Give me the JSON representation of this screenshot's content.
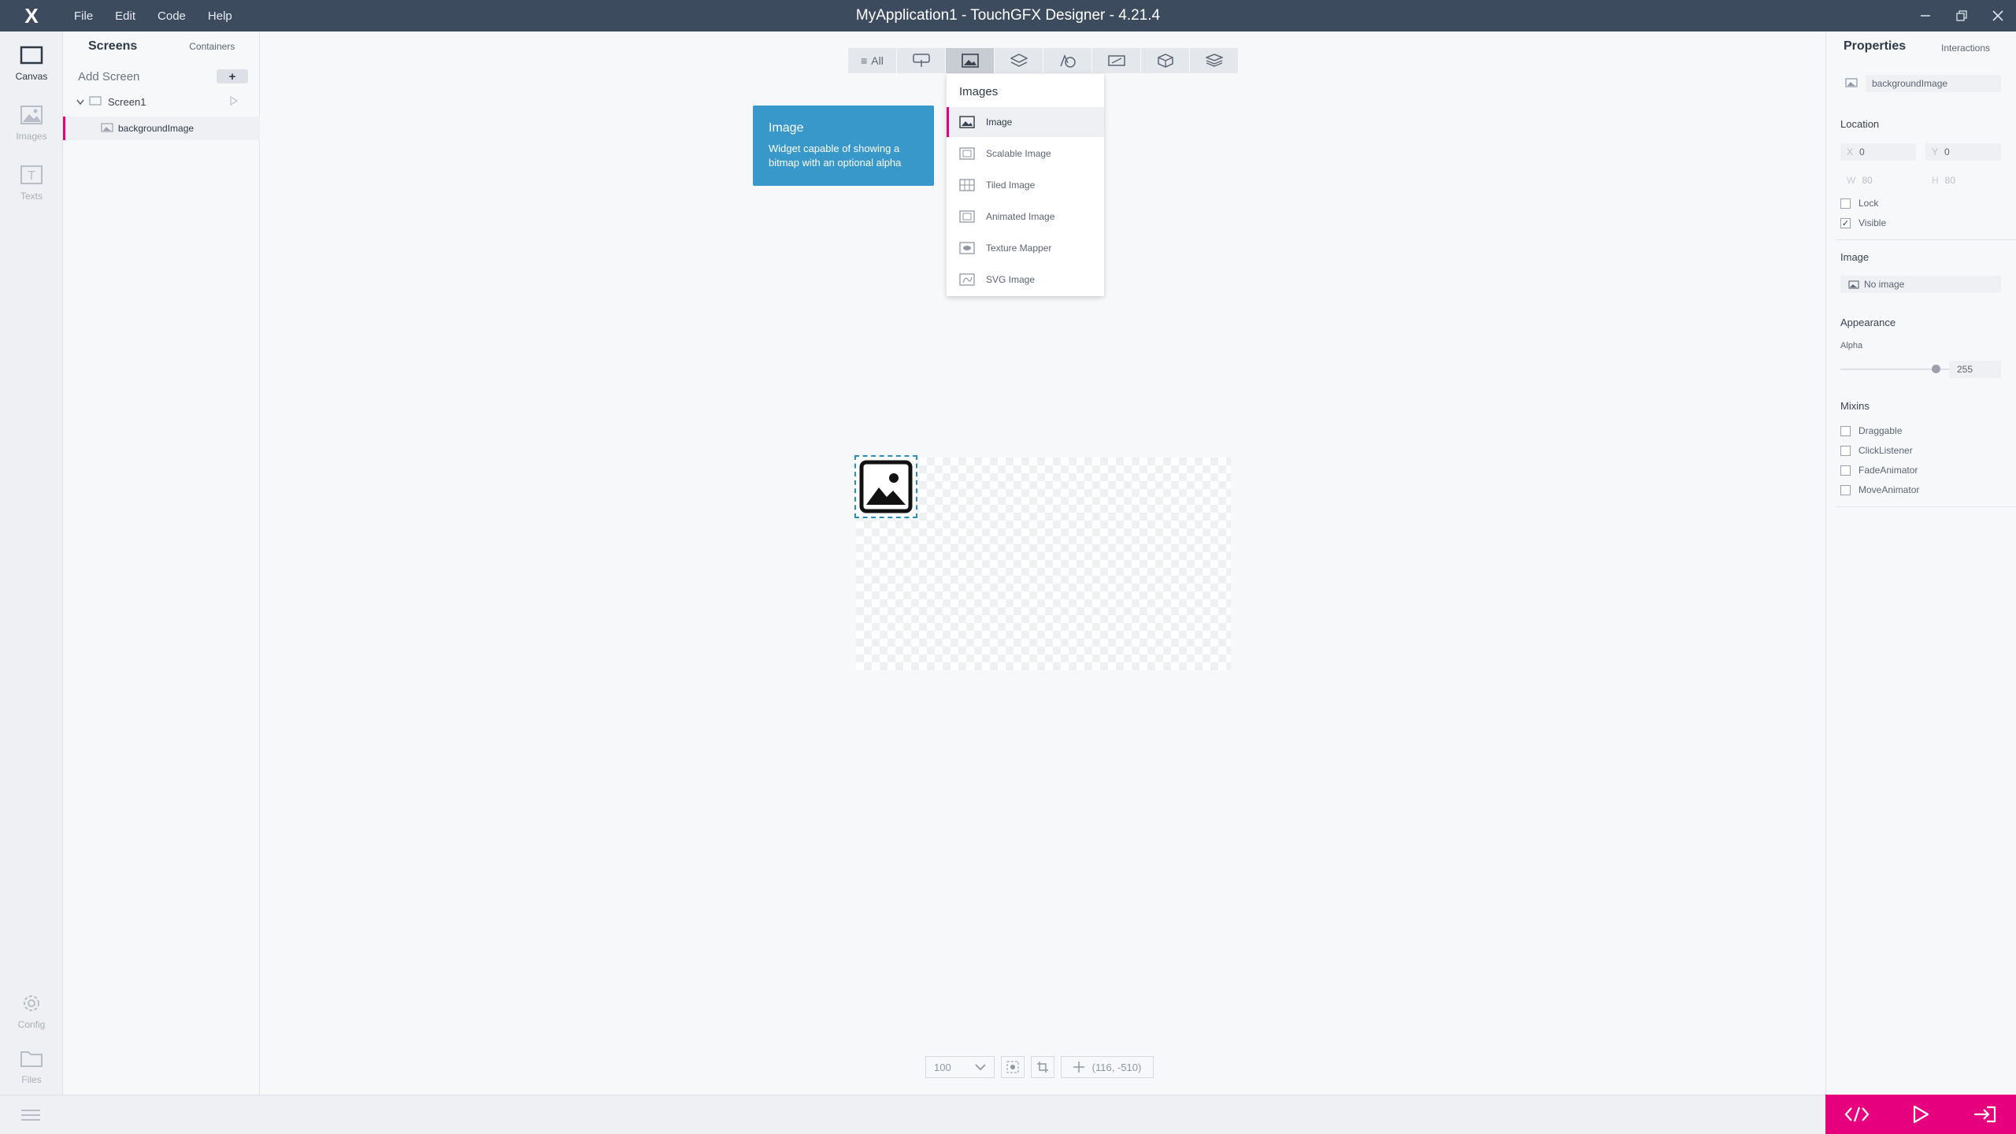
{
  "window": {
    "title": "MyApplication1 - TouchGFX Designer - 4.21.4",
    "logo": "X",
    "menu": [
      "File",
      "Edit",
      "Code",
      "Help"
    ],
    "controls": [
      "minimize-icon",
      "restore-icon",
      "close-icon"
    ]
  },
  "rail": {
    "items": [
      {
        "label": "Canvas",
        "icon": "canvas-icon",
        "active": true
      },
      {
        "label": "Images",
        "icon": "images-icon",
        "active": false
      },
      {
        "label": "Texts",
        "icon": "texts-icon",
        "active": false
      },
      {
        "label": "Config",
        "icon": "gear-icon",
        "active": false
      },
      {
        "label": "Files",
        "icon": "folder-icon",
        "active": false
      }
    ]
  },
  "screens_panel": {
    "tab_screens": "Screens",
    "tab_containers": "Containers",
    "add_screen": "Add Screen",
    "add_button": "+",
    "tree": [
      {
        "label": "Screen1",
        "level": 0
      },
      {
        "label": "backgroundImage",
        "level": 1,
        "selected": true
      }
    ]
  },
  "toolbar": {
    "all_label": "All",
    "categories": [
      "all",
      "interaction",
      "images",
      "containers",
      "shapes",
      "miscellaneous",
      "3d",
      "layers"
    ]
  },
  "tooltip": {
    "title": "Image",
    "body": "Widget capable of showing a bitmap with an optional alpha"
  },
  "dropdown": {
    "header": "Images",
    "items": [
      "Image",
      "Scalable Image",
      "Tiled Image",
      "Animated Image",
      "Texture Mapper",
      "SVG Image"
    ],
    "selected": "Image"
  },
  "zoom": {
    "value": "100",
    "cursor": "(116, -510)"
  },
  "properties": {
    "title": "Properties",
    "tab_interactions": "Interactions",
    "widget_name": "backgroundImage",
    "location_label": "Location",
    "x_label": "X",
    "x_value": "0",
    "y_label": "Y",
    "y_value": "0",
    "w_label": "W",
    "w_value": "80",
    "h_label": "H",
    "h_value": "80",
    "lock_label": "Lock",
    "visible_label": "Visible",
    "image_label": "Image",
    "image_value": "No image",
    "appearance_label": "Appearance",
    "alpha_label": "Alpha",
    "alpha_value": "255",
    "mixins_label": "Mixins",
    "mixins": [
      "Draggable",
      "ClickListener",
      "FadeAnimator",
      "MoveAnimator"
    ]
  },
  "colors": {
    "titlebar": "#3d4b5e",
    "accent": "#e6007e",
    "tooltip": "#3798c9",
    "selection_border": "#2a8fb8"
  }
}
